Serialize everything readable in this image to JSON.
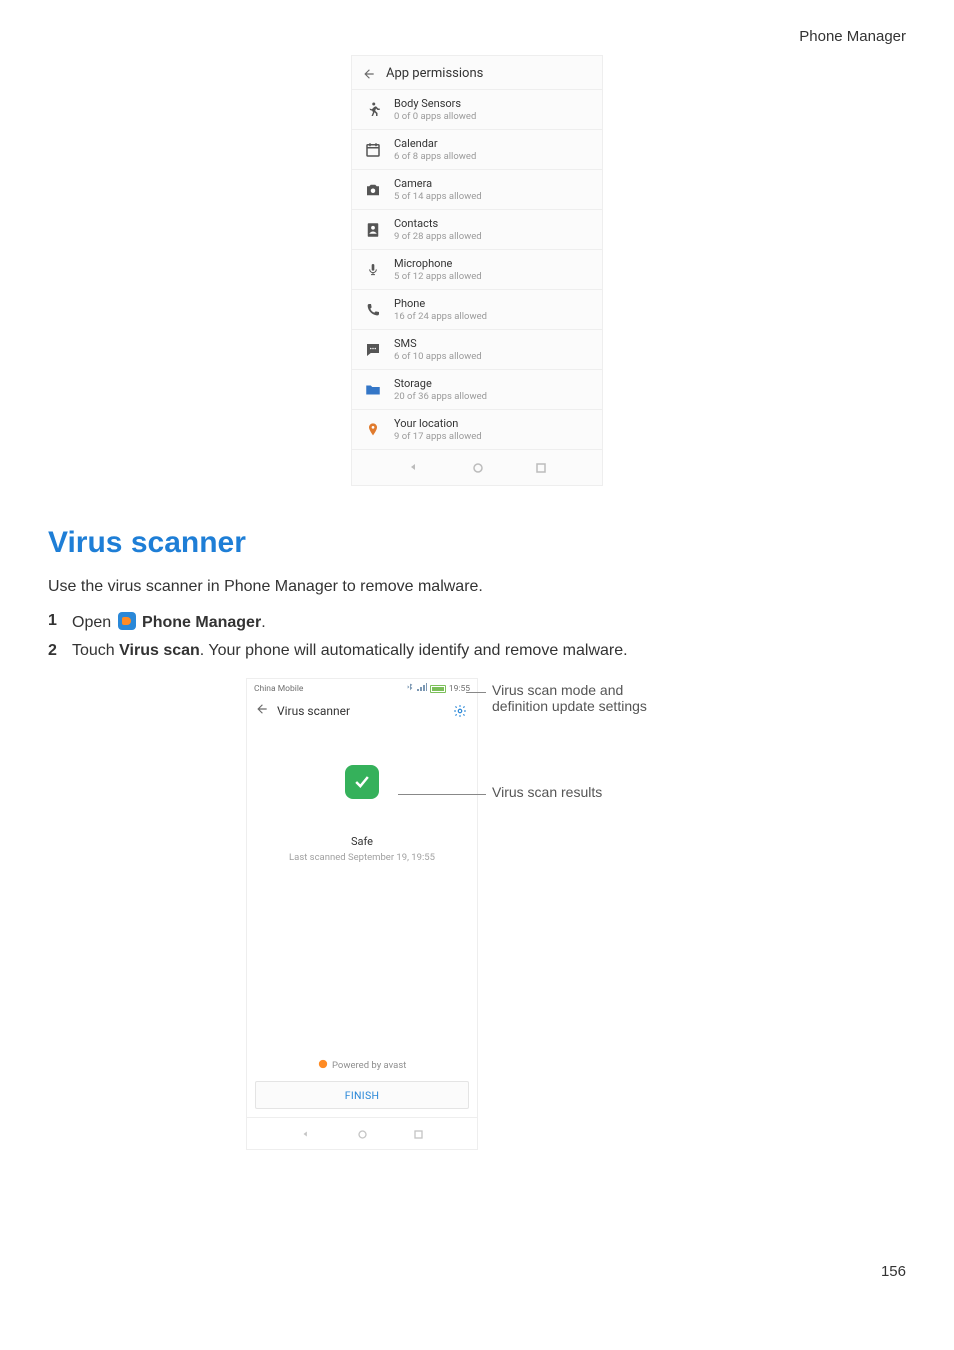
{
  "header": {
    "title": "Phone Manager"
  },
  "page_number": "156",
  "screenshot1": {
    "header_title": "App permissions",
    "rows": [
      {
        "title": "Body Sensors",
        "sub": "0 of 0 apps allowed",
        "icon": "running"
      },
      {
        "title": "Calendar",
        "sub": "6 of 8 apps allowed",
        "icon": "calendar"
      },
      {
        "title": "Camera",
        "sub": "5 of 14 apps allowed",
        "icon": "camera"
      },
      {
        "title": "Contacts",
        "sub": "9 of 28 apps allowed",
        "icon": "contacts"
      },
      {
        "title": "Microphone",
        "sub": "5 of 12 apps allowed",
        "icon": "mic"
      },
      {
        "title": "Phone",
        "sub": "16 of 24 apps allowed",
        "icon": "phone"
      },
      {
        "title": "SMS",
        "sub": "6 of 10 apps allowed",
        "icon": "sms"
      },
      {
        "title": "Storage",
        "sub": "20 of 36 apps allowed",
        "icon": "folder"
      },
      {
        "title": "Your location",
        "sub": "9 of 17 apps allowed",
        "icon": "location"
      }
    ]
  },
  "section": {
    "title": "Virus scanner",
    "intro": "Use the virus scanner in Phone Manager to remove malware.",
    "step1_prefix": "Open ",
    "step1_app": "Phone Manager",
    "step1_suffix": ".",
    "step2_prefix": "Touch ",
    "step2_bold": "Virus scan",
    "step2_suffix": ". Your phone will automatically identify and remove malware.",
    "numbers": {
      "one": "1",
      "two": "2"
    }
  },
  "screenshot2": {
    "carrier": "China Mobile",
    "time": "19:55",
    "header_title": "Virus scanner",
    "safe_label": "Safe",
    "last_scanned": "Last scanned September 19, 19:55",
    "powered": "Powered by avast",
    "finish": "FINISH"
  },
  "callouts": {
    "top_line1": "Virus scan mode and",
    "top_line2": "definition update settings",
    "mid": "Virus scan results"
  }
}
